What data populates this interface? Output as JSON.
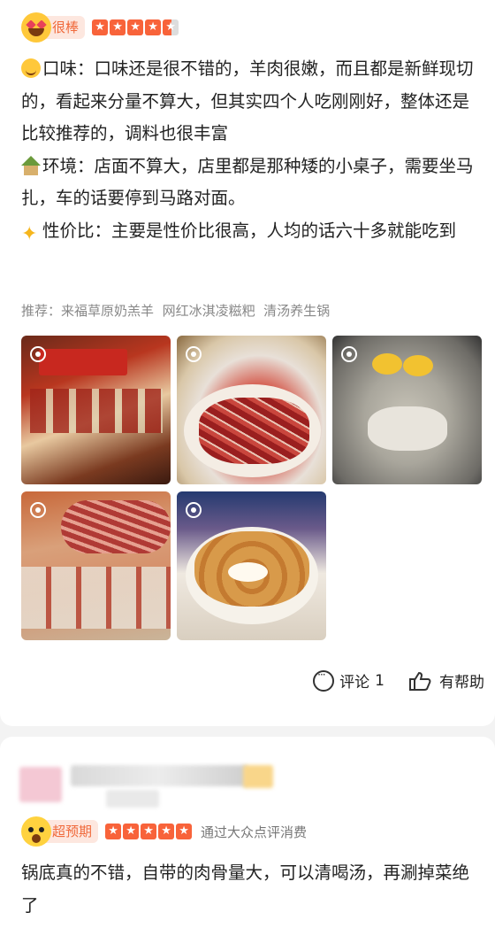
{
  "review1": {
    "badge": "很棒",
    "stars": 4.5,
    "paragraphs": [
      {
        "icon": "smile-emoji-icon",
        "text": "口味：口味还是很不错的，羊肉很嫩，而且都是新鲜现切的，看起来分量不算大，但其实四个人吃刚刚好，整体还是比较推荐的，调料也很丰富"
      },
      {
        "icon": "house-emoji-icon",
        "text": "环境：店面不算大，店里都是那种矮的小桌子，需要坐马扎，车的话要停到马路对面。"
      },
      {
        "icon": "sparkle-emoji-icon",
        "text": "性价比：主要是性价比很高，人均的话六十多就能吃到"
      }
    ],
    "recommend_label": "推荐：",
    "recommend_items": [
      "来福草原奶羔羊",
      "网红冰淇凌糍粑",
      "清汤养生锅"
    ],
    "photo_count": 5,
    "comment_label": "评论",
    "comment_count": "1",
    "helpful_label": "有帮助"
  },
  "review2": {
    "badge": "超预期",
    "stars": 5,
    "via": "通过大众点评消费",
    "text": "锅底真的不错，自带的肉骨量大，可以清喝汤，再涮掉菜绝了"
  },
  "colors": {
    "accent": "#f8633a",
    "badge_bg": "#fde7df",
    "badge_text": "#f06a3c"
  }
}
